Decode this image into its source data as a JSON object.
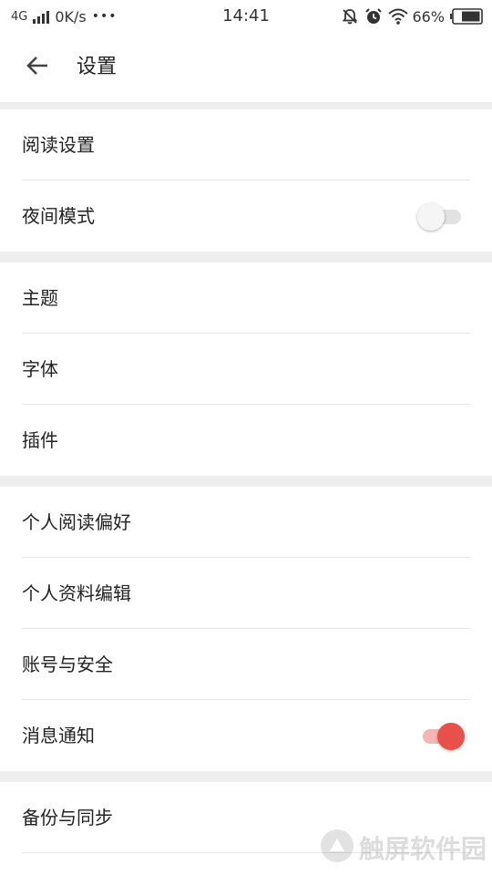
{
  "status_bar": {
    "network": "4G",
    "speed": "0K/s",
    "more": "•••",
    "time": "14:41",
    "battery_pct": "66%",
    "icons": [
      "signal-icon",
      "mute-bell-icon",
      "alarm-icon",
      "wifi-icon",
      "battery-icon"
    ]
  },
  "app_bar": {
    "back_icon": "arrow-left-icon",
    "title": "设置"
  },
  "sections": [
    {
      "items": [
        {
          "label": "阅读设置"
        },
        {
          "label": "夜间模式",
          "toggle": {
            "on": false
          }
        }
      ]
    },
    {
      "items": [
        {
          "label": "主题"
        },
        {
          "label": "字体"
        },
        {
          "label": "插件"
        }
      ]
    },
    {
      "items": [
        {
          "label": "个人阅读偏好"
        },
        {
          "label": "个人资料编辑"
        },
        {
          "label": "账号与安全"
        },
        {
          "label": "消息通知",
          "toggle": {
            "on": true
          }
        }
      ]
    },
    {
      "items": [
        {
          "label": "备份与同步"
        }
      ]
    }
  ],
  "colors": {
    "accent": "#e8504a",
    "accent_track": "#f4b6b3",
    "separator": "#eeeeee"
  },
  "watermark": {
    "text": "触屏软件园",
    "icon": "watermark-logo-icon"
  }
}
